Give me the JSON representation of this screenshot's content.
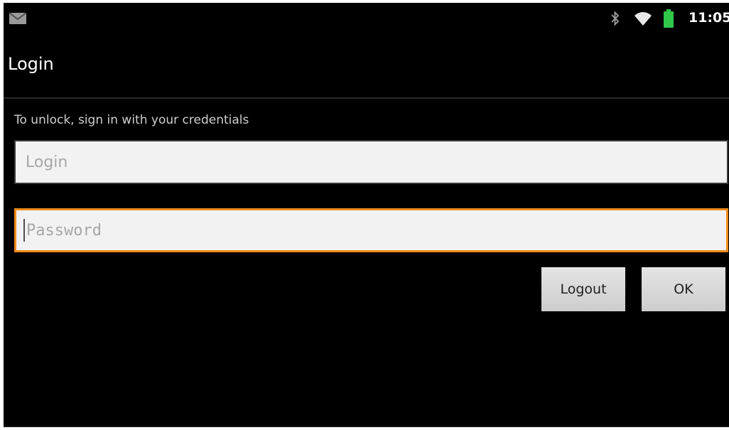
{
  "status_bar": {
    "time": "11:05",
    "icons": {
      "notification": "mail-icon",
      "bluetooth": "bluetooth-icon",
      "wifi": "wifi-icon",
      "battery": "battery-icon"
    },
    "battery_color": "#31c84a"
  },
  "screen": {
    "title": "Login",
    "prompt": "To unlock, sign in with your credentials"
  },
  "form": {
    "login": {
      "value": "",
      "placeholder": "Login"
    },
    "password": {
      "value": "",
      "placeholder": "Password",
      "focused": true
    }
  },
  "buttons": {
    "logout_label": "Logout",
    "ok_label": "OK"
  },
  "colors": {
    "background": "#000000",
    "focus_accent": "#f08a1c"
  }
}
